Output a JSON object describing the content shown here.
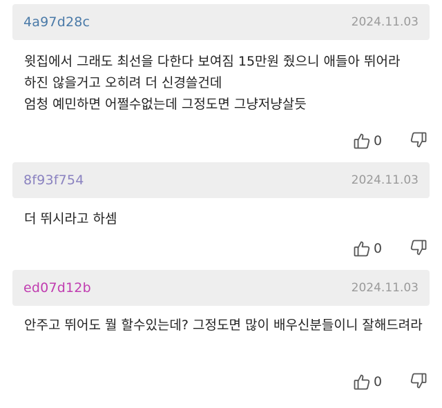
{
  "colors": {
    "header_bg": "#eeeeee",
    "date": "#9a9a9a",
    "body_text": "#222222"
  },
  "comments": [
    {
      "author": "4a97d28c",
      "author_color": "#4a7aa8",
      "date": "2024.11.03",
      "body": "윗집에서 그래도 최선을 다한다 보여짐 15만원 줬으니 애들아 뛰어라 하진 않을거고 오히려 더 신경쓸건데\n엄청 예민하면 어쩔수없는데 그정도면 그냥저냥살듯",
      "likes": "0"
    },
    {
      "author": "8f93f754",
      "author_color": "#8a82c0",
      "date": "2024.11.03",
      "body": "더 뛰시라고 하셈",
      "likes": "0"
    },
    {
      "author": "ed07d12b",
      "author_color": "#c03cb0",
      "date": "2024.11.03",
      "body": "안주고 뛰어도 뭘 할수있는데? 그정도면 많이 배우신분들이니 잘해드려라",
      "likes": "0"
    }
  ]
}
